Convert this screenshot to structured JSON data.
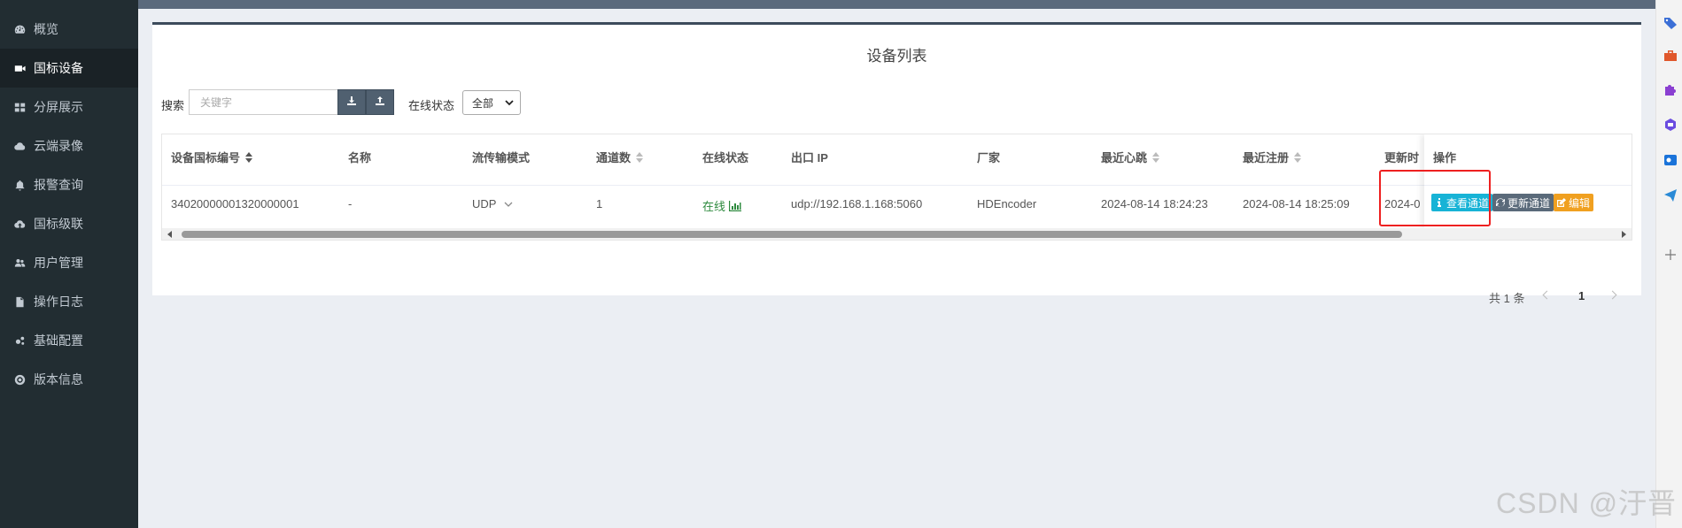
{
  "sidebar": {
    "items": [
      {
        "label": "概览",
        "icon": "dashboard-icon"
      },
      {
        "label": "国标设备",
        "icon": "video-camera-icon",
        "active": true
      },
      {
        "label": "分屏展示",
        "icon": "grid-icon"
      },
      {
        "label": "云端录像",
        "icon": "cloud-icon"
      },
      {
        "label": "报警查询",
        "icon": "bell-icon"
      },
      {
        "label": "国标级联",
        "icon": "cloud-upload-icon"
      },
      {
        "label": "用户管理",
        "icon": "users-icon"
      },
      {
        "label": "操作日志",
        "icon": "file-icon"
      },
      {
        "label": "基础配置",
        "icon": "gears-icon"
      },
      {
        "label": "版本信息",
        "icon": "lifebuoy-icon"
      }
    ]
  },
  "panel": {
    "title": "设备列表"
  },
  "toolbar": {
    "search_label": "搜索",
    "search_placeholder": "关键字",
    "search_value": "",
    "download_icon": "download-icon",
    "upload_icon": "upload-icon",
    "status_label": "在线状态",
    "status_selected": "全部"
  },
  "table": {
    "columns": [
      "设备国标编号",
      "名称",
      "流传输模式",
      "通道数",
      "在线状态",
      "出口 IP",
      "厂家",
      "最近心跳",
      "最近注册",
      "更新时",
      "操作"
    ],
    "rows": [
      {
        "device_id": "34020000001320000001",
        "name": "-",
        "stream_mode": "UDP",
        "channels": "1",
        "online_status": "在线",
        "ip": "udp://192.168.1.168:5060",
        "manufacturer": "HDEncoder",
        "last_keepalive": "2024-08-14 18:24:23",
        "last_register": "2024-08-14 18:25:09",
        "update_time": "2024-0"
      }
    ],
    "actions": {
      "view_channels": "查看通道",
      "refresh_channels": "更新通道",
      "edit": "编辑"
    },
    "colors": {
      "view_channels": "#17b3d6",
      "refresh_channels": "#5a6a7a",
      "edit": "#f0a020",
      "online": "#2e8a3e",
      "highlight": "#ee2020"
    }
  },
  "pagination": {
    "total": "共 1 条",
    "current_page": "1"
  },
  "watermark": "CSDN @汙晋"
}
